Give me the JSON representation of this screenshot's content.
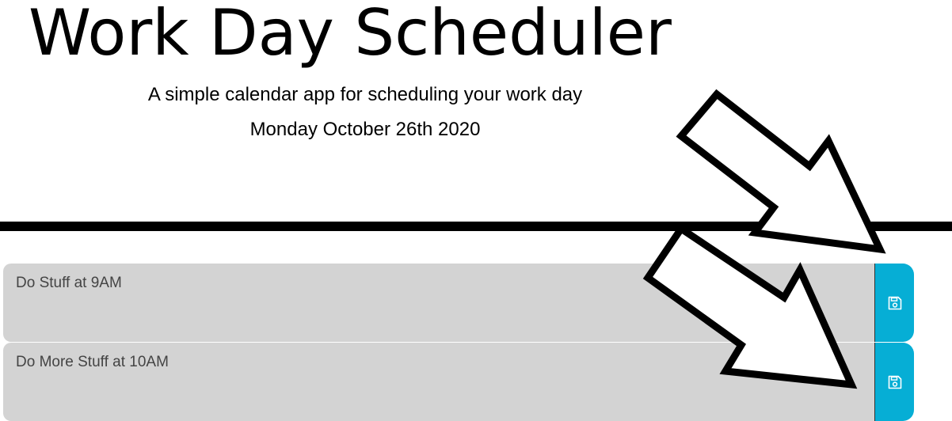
{
  "header": {
    "title": "Work Day Scheduler",
    "subtitle": "A simple calendar app for scheduling your work day",
    "current_date": "Monday October 26th 2020"
  },
  "timeblocks": [
    {
      "description": "Do Stuff at 9AM",
      "save_icon": "floppy-disk-icon"
    },
    {
      "description": "Do More Stuff at 10AM",
      "save_icon": "floppy-disk-icon"
    }
  ],
  "colors": {
    "textarea_bg": "#d3d3d3",
    "save_button": "#06aed5",
    "annotation_arrows": "#000000"
  }
}
